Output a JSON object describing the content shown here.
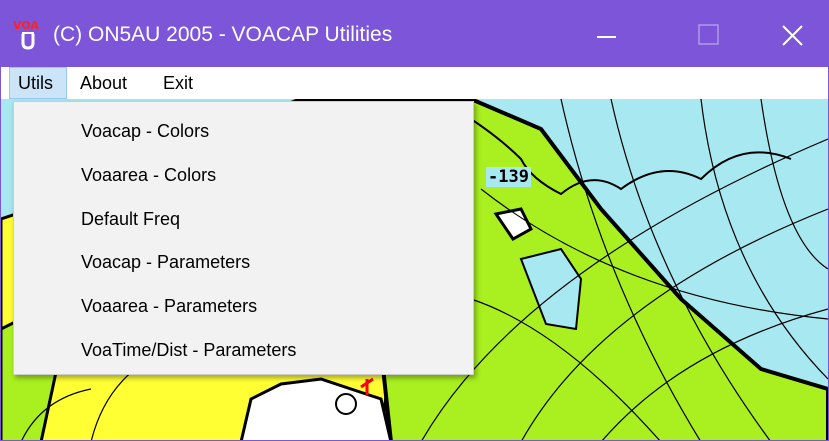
{
  "window": {
    "title": "(C) ON5AU 2005 - VOACAP Utilities",
    "icon": "voacap-app-icon",
    "controls": {
      "minimize": "minimize-icon",
      "maximize": "maximize-icon",
      "close": "close-icon"
    },
    "colors": {
      "titlebar": "#7d55d8",
      "menu_highlight": "#cce4f7"
    }
  },
  "menubar": {
    "items": [
      {
        "label": "Utils",
        "active": true
      },
      {
        "label": "About",
        "active": false
      },
      {
        "label": "Exit",
        "active": false
      }
    ]
  },
  "dropdown": {
    "items": [
      {
        "label": "Voacap - Colors"
      },
      {
        "label": "Voaarea - Colors"
      },
      {
        "label": "Default Freq"
      },
      {
        "label": "Voacap - Parameters"
      },
      {
        "label": "Voaarea - Parameters"
      },
      {
        "label": "VoaTime/Dist - Parameters"
      }
    ]
  },
  "map": {
    "contour_label": "-139",
    "colors": {
      "sea": "#a8e8f0",
      "green_zone": "#aaf020",
      "yellow_zone": "#ffff33",
      "land": "#ffffff"
    }
  }
}
